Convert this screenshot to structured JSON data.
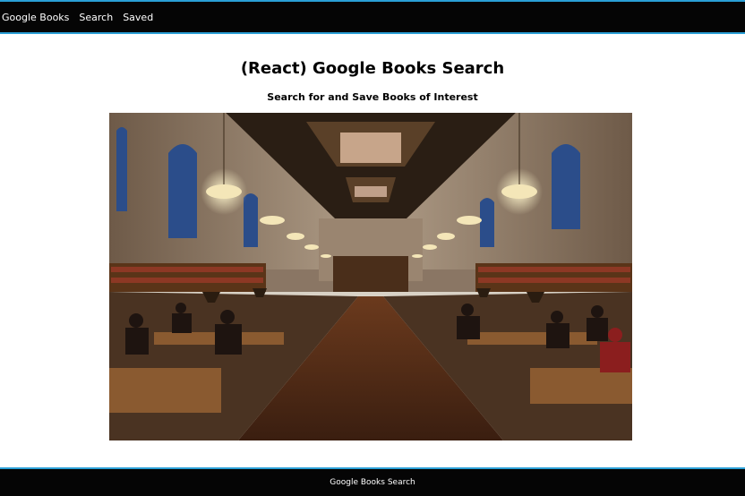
{
  "navbar": {
    "brand": "Google Books",
    "links": [
      "Search",
      "Saved"
    ]
  },
  "header": {
    "title": "(React) Google Books Search",
    "subtitle": "Search for and Save Books of Interest"
  },
  "hero_image": {
    "description_icon": "library-reading-room-image"
  },
  "footer": {
    "text": "Google Books Search"
  },
  "colors": {
    "nav_bg": "#050505",
    "accent_border": "#2a9fd6",
    "page_bg": "#ffffff"
  }
}
